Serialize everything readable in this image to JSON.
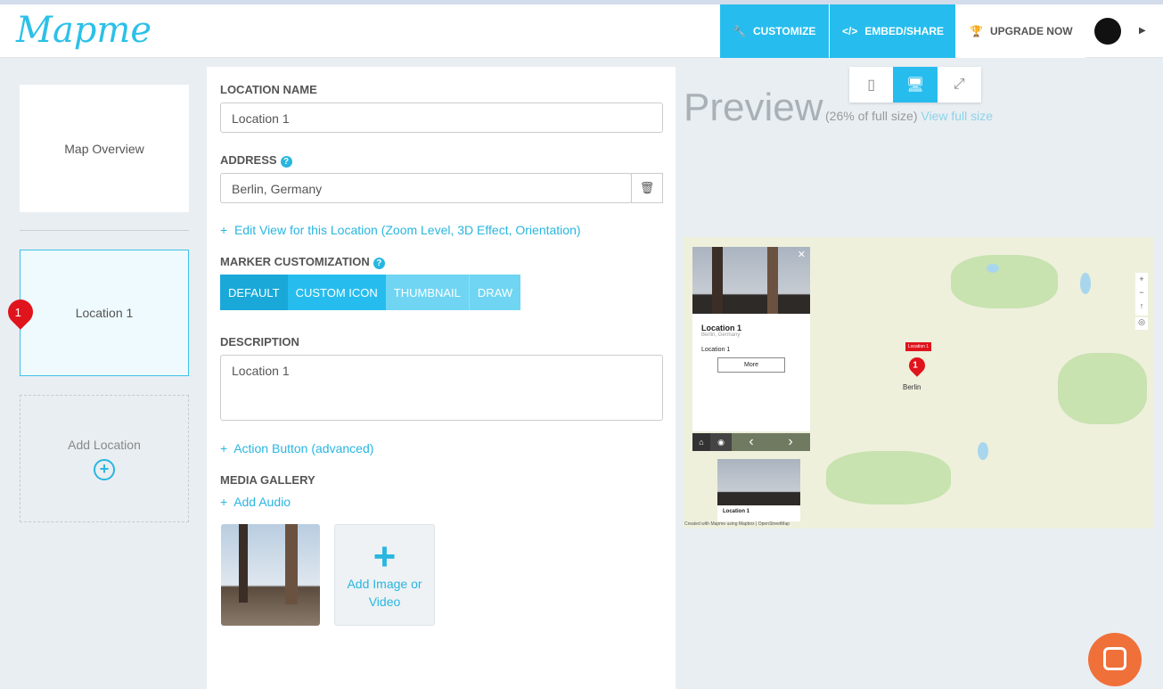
{
  "header": {
    "logo": "Mapme",
    "customize": "CUSTOMIZE",
    "embed": "EMBED/SHARE",
    "upgrade": "UPGRADE NOW"
  },
  "sidebar": {
    "overview": "Map Overview",
    "location": "Location 1",
    "marker_number": "1",
    "add": "Add Location"
  },
  "form": {
    "location_name_label": "LOCATION NAME",
    "location_name_value": "Location 1",
    "address_label": "ADDRESS",
    "address_value": "Berlin, Germany",
    "edit_view": "Edit View for this Location (Zoom Level, 3D Effect, Orientation)",
    "marker_label": "MARKER CUSTOMIZATION",
    "marker_tabs": [
      "DEFAULT",
      "CUSTOM ICON",
      "THUMBNAIL",
      "DRAW"
    ],
    "description_label": "DESCRIPTION",
    "description_value": "Location 1",
    "action_button": "Action Button (advanced)",
    "media_label": "MEDIA GALLERY",
    "add_audio": "Add Audio",
    "add_media": "Add Image or Video"
  },
  "preview": {
    "title": "Preview",
    "scale": "(26% of full size)",
    "view_full": "View full size",
    "popup_title": "Location 1",
    "popup_address": "Berlin, Germany",
    "popup_desc": "Location 1",
    "more": "More",
    "marker_tooltip": "Location 1",
    "city": "Berlin",
    "thumb_label": "Location 1",
    "attribution": "Created with Mapme using Mapbox | OpenStreetMap"
  },
  "colors": {
    "accent": "#26bdee",
    "marker": "#e0141c",
    "chat": "#f0703a"
  }
}
